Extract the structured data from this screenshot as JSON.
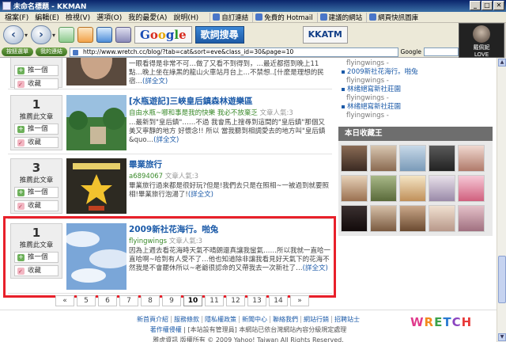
{
  "window": {
    "title": "未命名標題 - KKMAN"
  },
  "menu": {
    "items": [
      "檔案(F)",
      "編輯(E)",
      "檢視(V)",
      "選項(O)",
      "我的最愛(A)",
      "說明(H)"
    ],
    "quicklinks": [
      "自訂連結",
      "免費的 Hotmail",
      "建議的網站",
      "網頁快訊圖庫"
    ]
  },
  "toolbar": {
    "google_label": "Google",
    "song_label": "歌詞搜尋",
    "kkatm_label": "KKATM"
  },
  "avatar": {
    "line1": "戴佩妮",
    "line2": "LOVE MOMENTS"
  },
  "address": {
    "pill1": "按鈕選單",
    "pill2": "我的連結",
    "url": "http://www.wretch.cc/blog/?tab=cat&sort=eve&class_id=30&page=10",
    "google_label": "Google"
  },
  "cards": [
    {
      "votes": "",
      "vote_label": "",
      "push_label": "推一個",
      "fav_label": "收藏",
      "title": "",
      "author": "",
      "popularity": "",
      "excerpt": "一眼看得是非常不可…做了又看不到得到，…最近都搭到晚上11點…晚上坐在綠黑的龍山火車站月台上…不禁想..[什麼是理想的民宿…",
      "more": "(詳全文)"
    },
    {
      "votes": "1",
      "vote_label": "推薦此文章",
      "push_label": "推一個",
      "fav_label": "收藏",
      "title": "[水瓶遊記]三峽皇后鎮森林遊樂區",
      "author": "自由水瓶~哪和事是我的快樂 我必不放棄乏",
      "popularity": "文章人氣:3",
      "excerpt": "…最新到\"皇后鎮\"……不過 我會馬上搜尋到這間的\"皇后鎮\"那個又美又寧靜的地方 好懷念!! 所以 當我聽到相調愛去的地方叫\"皇后鎮&quo…",
      "more": "(詳全文)"
    },
    {
      "votes": "3",
      "vote_label": "推薦此文章",
      "push_label": "推一個",
      "fav_label": "收藏",
      "title": "畢業旅行",
      "author": "a6894067",
      "popularity": "文章人氣:3",
      "excerpt": "畢業旅行過來都是很好玩?但是!我們去只是在照相~一被過到就要照相!畢業旅行泡湯了!",
      "more": "(詳全文)"
    },
    {
      "votes": "1",
      "vote_label": "推薦此文章",
      "push_label": "推一個",
      "fav_label": "收藏",
      "title": "2009新社花海行。啪兔",
      "author": "flyingwings",
      "popularity": "文章人氣:3",
      "excerpt": "因為上週去看花海時天氣不晴朗還真讓我蠻氣……所以我就一直哈一直哈啊~哈到有人受不了…他也知道除非讓我看見好天氣下的花海不然我是不會罷休所以~老爺很認命的又帶我去一次新社了…",
      "more": "(詳全文)"
    }
  ],
  "pager": [
    "«",
    "5",
    "6",
    "7",
    "8",
    "9",
    "10",
    "11",
    "12",
    "13",
    "14",
    "»"
  ],
  "pager_current": "10",
  "sidebar": {
    "entries": [
      {
        "user": "flyingwings -"
      },
      {
        "link": "2009新社花海行。啪兔",
        "user": "flyingwings -"
      },
      {
        "link": "林绪絕寫新社莊園",
        "user": "flyingwings -"
      },
      {
        "link": "林绪絕寫新社莊園",
        "user": "flyingwings -"
      }
    ],
    "fav_title": "本日收藏王"
  },
  "footer": {
    "links": [
      "新首頁介紹",
      "服務條款",
      "隱私權政策",
      "新聞中心",
      "聯絡我們",
      "網站行銷",
      "招聘站士"
    ],
    "line2_link1": "著作權侵權",
    "line2_text": "[本站設有管理員] 本網站已依台灣網站內容分級規定處理",
    "line3": "雅虎資訊 版權所有 © 2009 Yahoo! Taiwan All Rights Reserved.",
    "logo": "WRETCH"
  }
}
